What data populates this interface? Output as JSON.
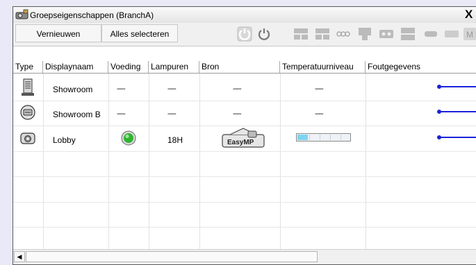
{
  "window": {
    "title": "Groepseigenschappen (BranchA)",
    "close_glyph": "X"
  },
  "toolbar": {
    "refresh_label": "Vernieuwen",
    "select_all_label": "Alles selecteren",
    "icons": [
      "power-on-icon",
      "power-off-icon",
      "input-computer-icon",
      "input-computer2-icon",
      "input-video-icon",
      "input-dvi-icon",
      "input-svideo-icon",
      "input-hdmi-icon",
      "input-easymp-icon",
      "input-usb-icon",
      "more-icon"
    ]
  },
  "table": {
    "columns": [
      "Type",
      "Displaynaam",
      "Voeding",
      "Lampuren",
      "Bron",
      "Temperatuurniveau",
      "Foutgegevens"
    ],
    "rows": [
      {
        "icon": "projector-tower-icon",
        "name": "Showroom",
        "power": "-----",
        "lamp": "-----",
        "source": "-----",
        "temp": "-----"
      },
      {
        "icon": "projector-round-icon",
        "name": "Showroom B",
        "power": "-----",
        "lamp": "-----",
        "source": "-----",
        "temp": "-----"
      },
      {
        "icon": "projector-camera-icon",
        "name": "Lobby",
        "power": "green",
        "lamp": "18H",
        "source": "EasyMP",
        "temp": "low"
      }
    ]
  },
  "colors": {
    "power_on": "#2fb52f",
    "error_line": "#1a22d8",
    "temp_fill": "#7fd3ef"
  }
}
